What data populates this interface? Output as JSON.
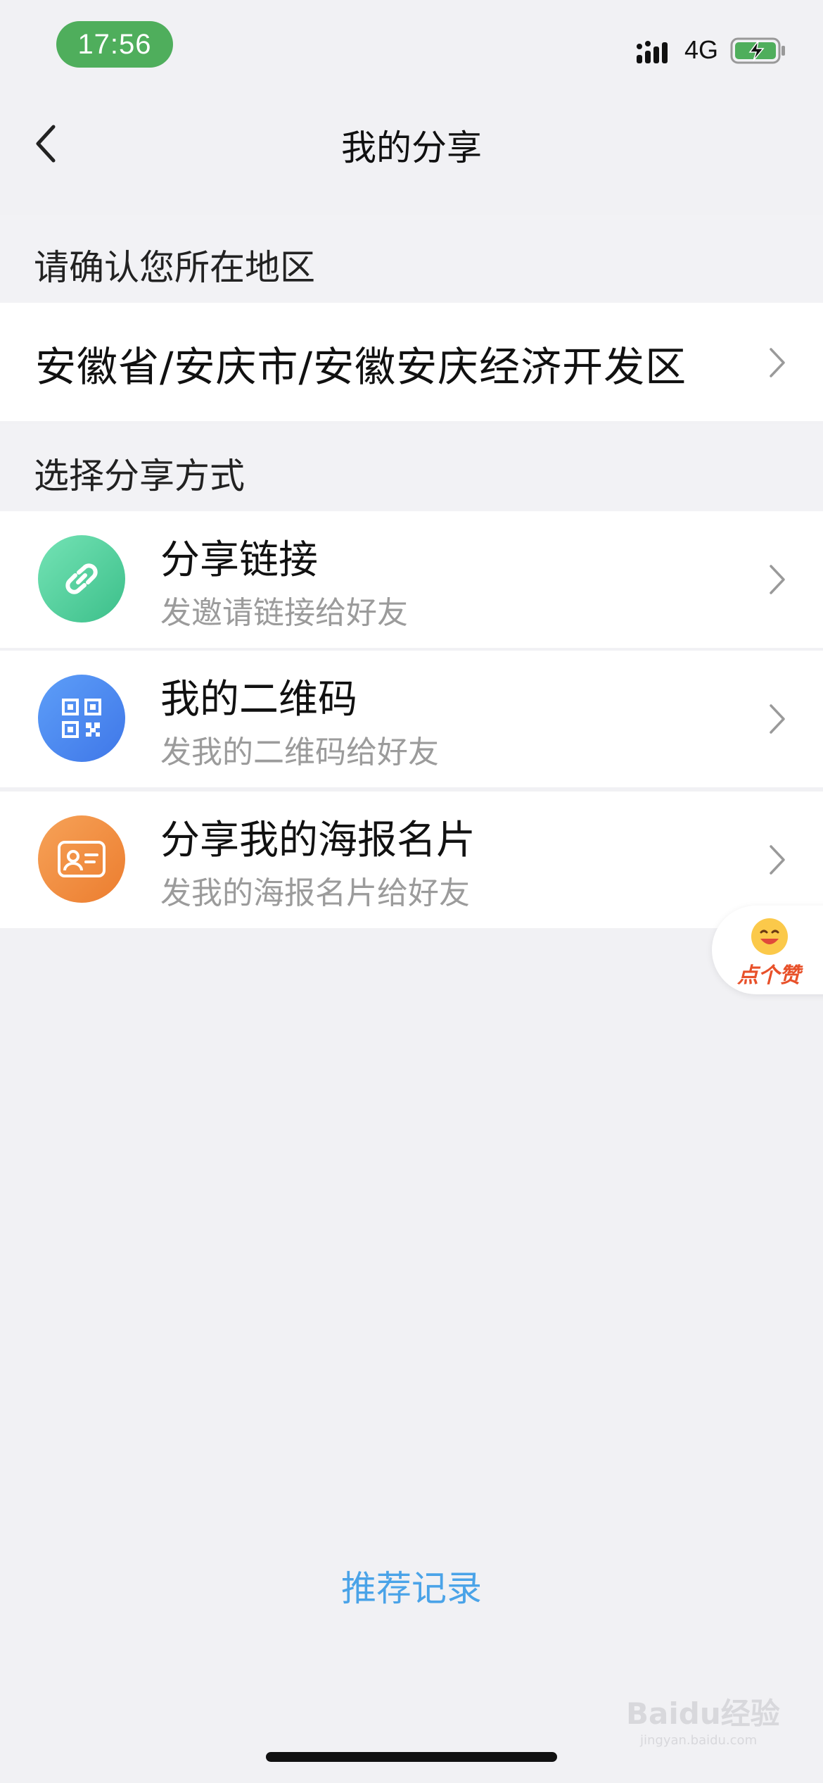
{
  "status_bar": {
    "time": "17:56",
    "network": "4G",
    "colors": {
      "time_pill": "#4fae5c",
      "battery": "#4fae5c"
    }
  },
  "nav": {
    "title": "我的分享"
  },
  "region_section": {
    "heading": "请确认您所在地区",
    "value": "安徽省/安庆市/安徽安庆经济开发区"
  },
  "share_section": {
    "heading": "选择分享方式",
    "options": [
      {
        "title": "分享链接",
        "subtitle": "发邀请链接给好友",
        "icon": "link-icon",
        "color": "#3cbf8a"
      },
      {
        "title": "我的二维码",
        "subtitle": "发我的二维码给好友",
        "icon": "qr-code-icon",
        "color": "#4f8cf0"
      },
      {
        "title": "分享我的海报名片",
        "subtitle": "发我的海报名片给好友",
        "icon": "id-card-icon",
        "color": "#ef8a3a"
      }
    ]
  },
  "like_badge": {
    "label": "点个赞"
  },
  "footer": {
    "link": "推荐记录"
  },
  "watermark": {
    "brand": "Baidu经验",
    "url": "jingyan.baidu.com"
  }
}
